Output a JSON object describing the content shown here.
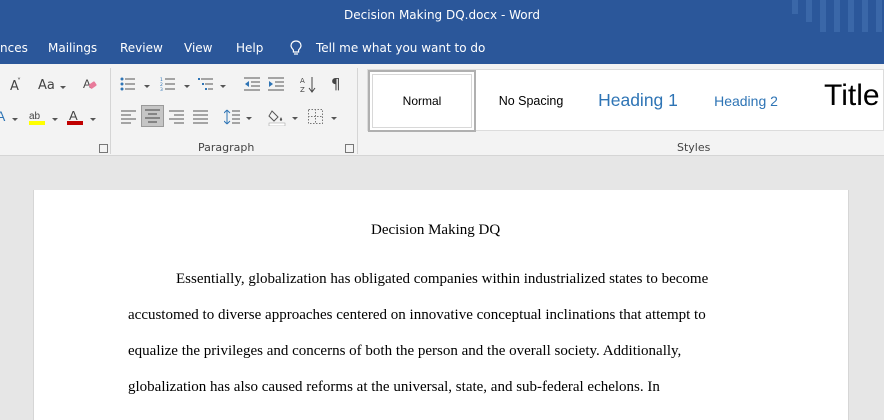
{
  "window": {
    "title": "Decision Making DQ.docx  -  Word"
  },
  "menu": {
    "items": [
      {
        "label": "nces"
      },
      {
        "label": "Mailings"
      },
      {
        "label": "Review"
      },
      {
        "label": "View"
      },
      {
        "label": "Help"
      }
    ],
    "tell_me": "Tell me what you want to do"
  },
  "ribbon": {
    "font_size_icons": [
      "A",
      "Aa"
    ],
    "paragraph_label": "Paragraph",
    "styles_label": "Styles",
    "pilcrow": "¶",
    "styles": [
      {
        "label": "Normal",
        "selected": true
      },
      {
        "label": "No Spacing"
      },
      {
        "label": "Heading 1"
      },
      {
        "label": "Heading 2"
      },
      {
        "label": "Title"
      }
    ],
    "colors": {
      "highlight": "#ffff00",
      "font_color": "#c00000",
      "heading": "#2e74b5",
      "accent": "#2b579a"
    }
  },
  "document": {
    "heading": "Decision Making DQ",
    "lines": [
      "Essentially, globalization has obligated companies within industrialized states to become",
      "accustomed to diverse approaches centered on innovative conceptual inclinations that attempt to",
      "equalize the privileges and concerns of both the person and the overall society. Additionally,",
      "globalization has also caused reforms at the universal, state, and sub-federal echelons. In"
    ]
  }
}
